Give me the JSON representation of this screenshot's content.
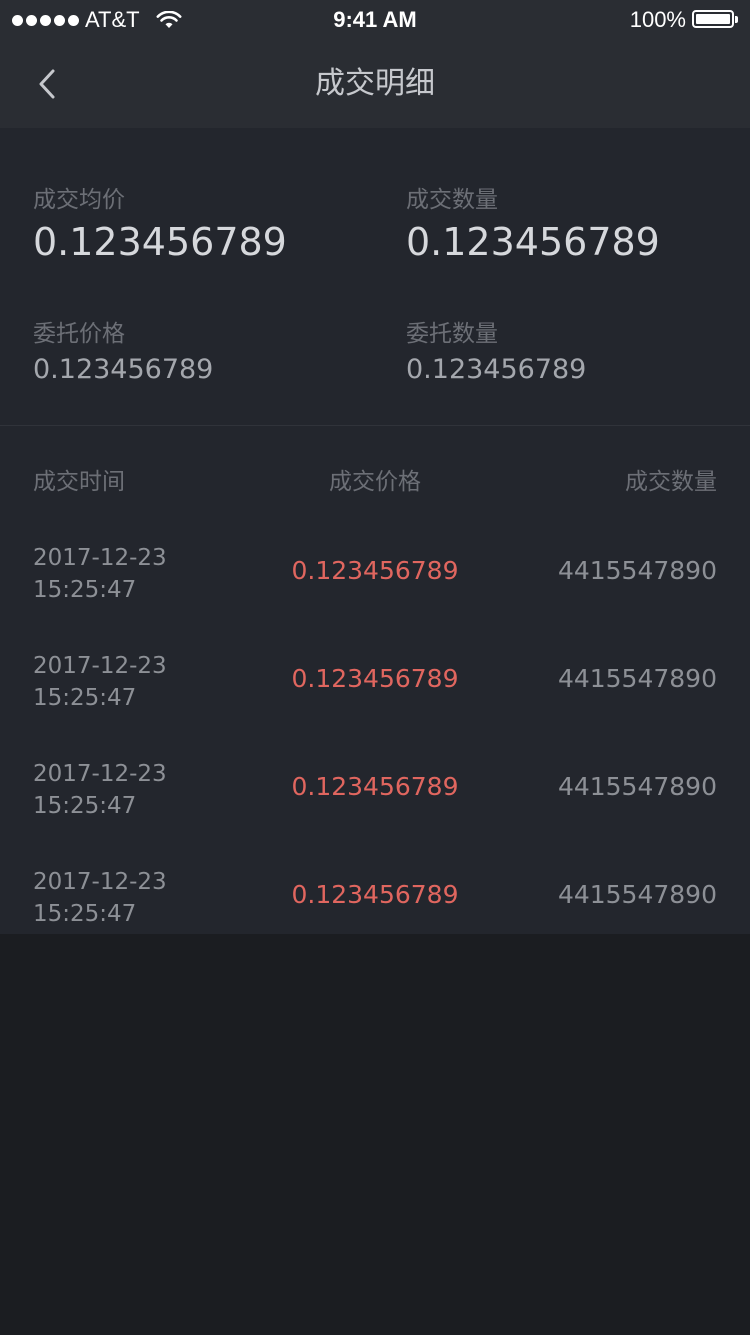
{
  "status_bar": {
    "carrier": "AT&T",
    "time": "9:41 AM",
    "battery": "100%"
  },
  "nav": {
    "title": "成交明细",
    "back_icon": "chevron-left-icon"
  },
  "summary": {
    "avg_price_label": "成交均价",
    "avg_price_value": "0.123456789",
    "deal_qty_label": "成交数量",
    "deal_qty_value": "0.123456789",
    "order_price_label": "委托价格",
    "order_price_value": "0.123456789",
    "order_qty_label": "委托数量",
    "order_qty_value": "0.123456789"
  },
  "table": {
    "headers": {
      "time": "成交时间",
      "price": "成交价格",
      "qty": "成交数量"
    },
    "rows": [
      {
        "date": "2017-12-23",
        "time": "15:25:47",
        "price": "0.123456789",
        "qty": "4415547890"
      },
      {
        "date": "2017-12-23",
        "time": "15:25:47",
        "price": "0.123456789",
        "qty": "4415547890"
      },
      {
        "date": "2017-12-23",
        "time": "15:25:47",
        "price": "0.123456789",
        "qty": "4415547890"
      },
      {
        "date": "2017-12-23",
        "time": "15:25:47",
        "price": "0.123456789",
        "qty": "4415547890"
      }
    ]
  },
  "colors": {
    "price_red": "#e0665f",
    "background": "#1b1d21",
    "panel": "#23262d",
    "bar": "#2a2d33"
  }
}
